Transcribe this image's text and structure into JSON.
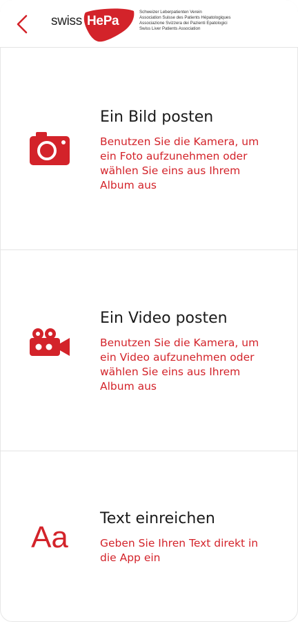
{
  "header": {
    "logo_prefix": "swiss",
    "logo_brand": "HePa",
    "tagline": [
      "Schweizer Leberpatienten Verein",
      "Association Suisse des Patients Hépatologiques",
      "Associazione Svizzera dei Pazienti Epatologici",
      "Swiss Liver Patients Association"
    ]
  },
  "options": [
    {
      "title": "Ein Bild posten",
      "desc_lines": [
        "Benutzen Sie die Kamera, um",
        "ein Foto aufzunehmen oder",
        "wählen Sie eins aus Ihrem",
        "Album aus"
      ],
      "icon": "camera-icon"
    },
    {
      "title": "Ein Video posten",
      "desc_lines": [
        "Benutzen Sie die Kamera, um",
        "ein Video aufzunehmen oder",
        "wählen Sie eins aus Ihrem",
        "Album aus"
      ],
      "icon": "video-camera-icon"
    },
    {
      "title": "Text einreichen",
      "desc_lines": [
        "Geben Sie Ihren Text direkt in",
        "die App ein"
      ],
      "icon": "text-icon",
      "icon_text": "Aa"
    }
  ],
  "colors": {
    "accent": "#d3232a",
    "title": "#1a1a1a",
    "divider": "#e4e4e4"
  }
}
